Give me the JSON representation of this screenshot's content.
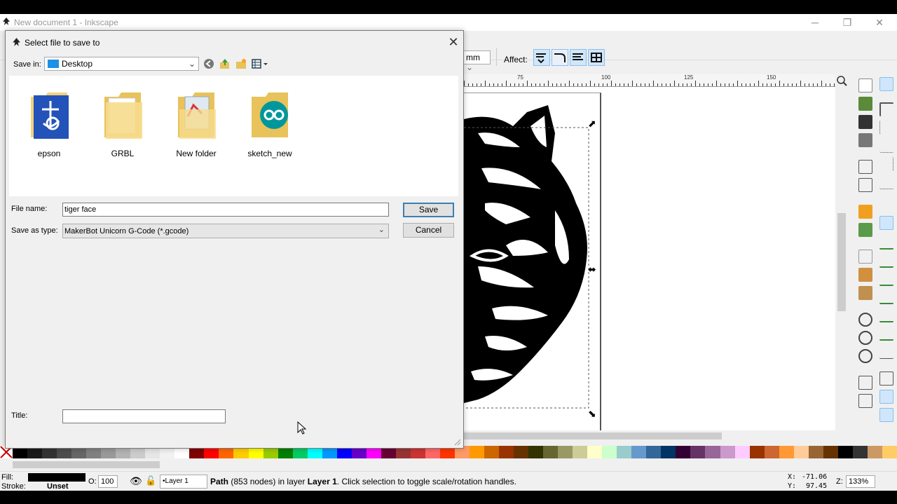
{
  "window": {
    "title": "New document 1 - Inkscape",
    "minimize": "─",
    "restore": "❐",
    "close": "✕"
  },
  "toolbar": {
    "unit": "mm",
    "affect_label": "Affect:"
  },
  "ruler": {
    "labels": [
      "75",
      "100",
      "125",
      "150"
    ]
  },
  "dialog": {
    "title": "Select file to save to",
    "close": "✕",
    "save_in_label": "Save in:",
    "save_in_value": "Desktop",
    "items": [
      {
        "name": "epson",
        "icon": "epson-folder-icon"
      },
      {
        "name": "GRBL",
        "icon": "folder-icon"
      },
      {
        "name": "New folder",
        "icon": "folder-icon"
      },
      {
        "name": "sketch_new",
        "icon": "arduino-folder-icon"
      }
    ],
    "file_name_label": "File name:",
    "file_name_value": "tiger face",
    "save_type_label": "Save as type:",
    "save_type_value": "MakerBot Unicorn G-Code (*.gcode)",
    "save_button": "Save",
    "cancel_button": "Cancel",
    "title_label": "Title:",
    "title_value": ""
  },
  "status": {
    "fill_label": "Fill:",
    "stroke_label": "Stroke:",
    "stroke_value": "Unset",
    "opacity_label": "O:",
    "opacity_value": "100",
    "layer_value": "•Layer 1",
    "message_prefix": "Path",
    "message_nodes": " (853 nodes) in layer ",
    "message_layer": "Layer 1",
    "message_suffix": ". Click selection to toggle scale/rotation handles.",
    "x_label": "X:",
    "x_value": "-71.06",
    "y_label": "Y:",
    "y_value": "97.45",
    "zoom_label": "Z:",
    "zoom_value": "133%"
  },
  "palette": [
    "#000000",
    "#1a1a1a",
    "#333333",
    "#4d4d4d",
    "#666666",
    "#808080",
    "#999999",
    "#b3b3b3",
    "#cccccc",
    "#e6e6e6",
    "#f2f2f2",
    "#ffffff",
    "#800000",
    "#ff0000",
    "#ff6600",
    "#ffcc00",
    "#ffff00",
    "#99cc00",
    "#008000",
    "#00cc66",
    "#00ffff",
    "#0099ff",
    "#0000ff",
    "#6600cc",
    "#ff00ff",
    "#660033",
    "#993333",
    "#cc3333",
    "#ff6666",
    "#ff3300",
    "#ff9966",
    "#ff9900",
    "#cc6600",
    "#993300",
    "#663300",
    "#333300",
    "#666633",
    "#999966",
    "#cccc99",
    "#ffffcc",
    "#ccffcc",
    "#99cccc",
    "#6699cc",
    "#336699",
    "#003366",
    "#330033",
    "#663366",
    "#996699",
    "#cc99cc",
    "#ffccff",
    "#993300",
    "#cc6633",
    "#ff9933",
    "#ffcc99",
    "#996633",
    "#663300",
    "#000000",
    "#333333",
    "#cc9966",
    "#ffcc66"
  ]
}
